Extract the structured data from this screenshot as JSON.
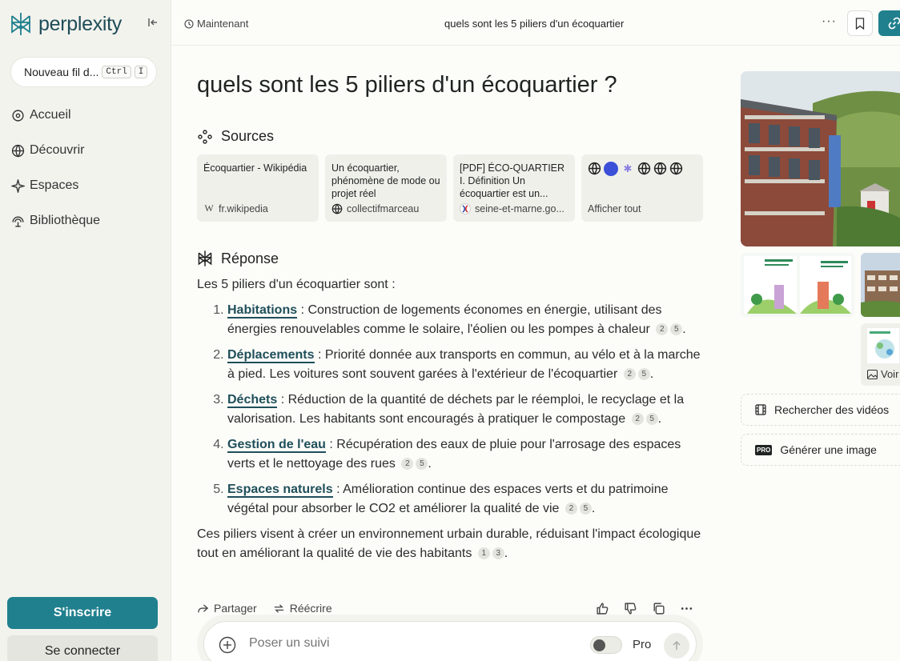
{
  "sidebar": {
    "logo_text": "perplexity",
    "new_thread_label": "Nouveau fil d...",
    "shortcut_key1": "Ctrl",
    "shortcut_key2": "I",
    "nav": [
      {
        "label": "Accueil",
        "icon": "search-icon"
      },
      {
        "label": "Découvrir",
        "icon": "globe-icon"
      },
      {
        "label": "Espaces",
        "icon": "sparkle-icon"
      },
      {
        "label": "Bibliothèque",
        "icon": "library-icon"
      }
    ],
    "signup_label": "S'inscrire",
    "login_label": "Se connecter"
  },
  "topbar": {
    "time_label": "Maintenant",
    "title": "quels sont les 5 piliers d'un écoquartier",
    "more_label": "···"
  },
  "thread": {
    "question": "quels sont les 5 piliers d'un écoquartier ?",
    "sources_heading": "Sources",
    "answer_heading": "Réponse",
    "sources": [
      {
        "title": "Écoquartier - Wikipédia",
        "domain": "fr.wikipedia",
        "favicon": "W"
      },
      {
        "title": "Un écoquartier, phénomène de mode ou projet réel",
        "domain": "collectifmarceau",
        "favicon": "globe-icon"
      },
      {
        "title": "[PDF] ÉCO-QUARTIER I. Définition Un écoquartier est un...",
        "domain": "seine-et-marne.go...",
        "favicon": "flag-icon"
      }
    ],
    "show_all_label": "Afficher tout",
    "intro": "Les 5 piliers d'un écoquartier sont :",
    "pillars": [
      {
        "keyword": "Habitations",
        "text": " : Construction de logements économes en énergie, utilisant des énergies renouvelables comme le solaire, l'éolien ou les pompes à chaleur",
        "cites": [
          "2",
          "5"
        ]
      },
      {
        "keyword": "Déplacements",
        "text": " : Priorité donnée aux transports en commun, au vélo et à la marche à pied. Les voitures sont souvent garées à l'extérieur de l'écoquartier",
        "cites": [
          "2",
          "5"
        ]
      },
      {
        "keyword": "Déchets",
        "text": " : Réduction de la quantité de déchets par le réemploi, le recyclage et la valorisation. Les habitants sont encouragés à pratiquer le compostage",
        "cites": [
          "2",
          "5"
        ]
      },
      {
        "keyword": "Gestion de l'eau",
        "text": " : Récupération des eaux de pluie pour l'arrosage des espaces verts et le nettoyage des rues",
        "cites": [
          "2",
          "5"
        ]
      },
      {
        "keyword": "Espaces naturels",
        "text": " : Amélioration continue des espaces verts et du patrimoine végétal pour absorber le CO2 et améliorer la qualité de vie",
        "cites": [
          "2",
          "5"
        ]
      }
    ],
    "conclusion": "Ces piliers visent à créer un environnement urbain durable, réduisant l'impact écologique tout en améliorant la qualité de vie des habitants",
    "conclusion_cites": [
      "1",
      "3"
    ],
    "share_label": "Partager",
    "rewrite_label": "Réécrire"
  },
  "followup": {
    "placeholder": "Poser un suivi",
    "pro_label": "Pro"
  },
  "right": {
    "see_more_label": "Voir",
    "search_videos_label": "Rechercher des vidéos",
    "generate_image_label": "Générer une image",
    "pro_badge": "PRO"
  },
  "colors": {
    "accent": "#20808d",
    "keyword": "#1f4f5a",
    "sidebar_bg": "#f3f3ee",
    "main_bg": "#fcfcf9"
  }
}
